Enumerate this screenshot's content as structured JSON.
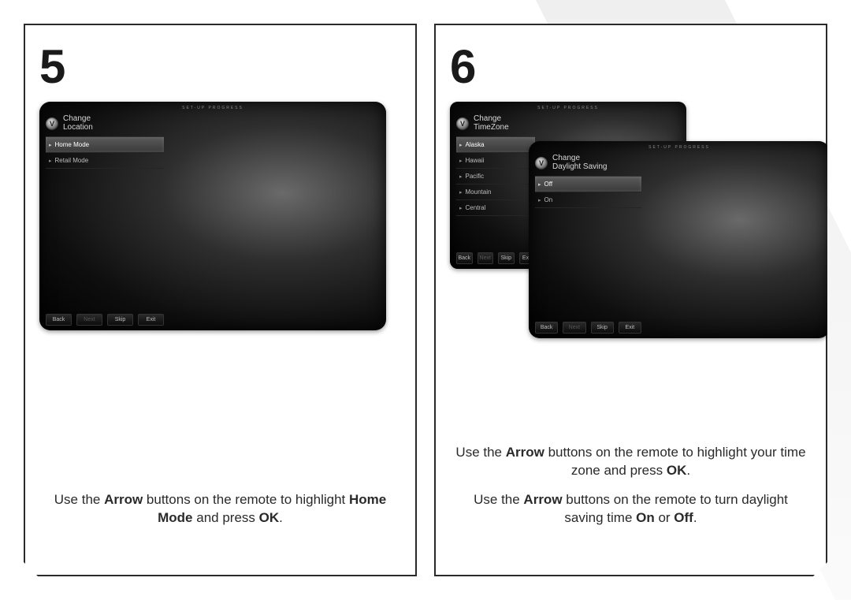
{
  "steps": {
    "left": {
      "number": "5",
      "instruction_parts": [
        "Use the ",
        "Arrow",
        " buttons on the remote to highlight ",
        "Home Mode",
        " and press ",
        "OK",
        "."
      ]
    },
    "right": {
      "number": "6",
      "instruction1_parts": [
        "Use the ",
        "Arrow",
        " buttons on the remote to highlight your time zone and press ",
        "OK",
        "."
      ],
      "instruction2_parts": [
        "Use the ",
        "Arrow",
        " buttons on the remote to turn daylight saving time ",
        "On",
        " or ",
        "Off",
        "."
      ]
    }
  },
  "tv": {
    "setup_header": "SET-UP PROGRESS",
    "logo_letter": "V",
    "location": {
      "title_line1": "Change",
      "title_line2": "Location",
      "items": [
        "Home Mode",
        "Retail Mode"
      ]
    },
    "timezone": {
      "title_line1": "Change",
      "title_line2": "TimeZone",
      "items": [
        "Alaska",
        "Hawaii",
        "Pacific",
        "Mountain",
        "Central"
      ]
    },
    "daylight": {
      "title_line1": "Change",
      "title_line2": "Daylight Saving",
      "items": [
        "Off",
        "On"
      ]
    },
    "footer": {
      "back": "Back",
      "next": "Next",
      "skip": "Skip",
      "exit": "Exit"
    }
  }
}
